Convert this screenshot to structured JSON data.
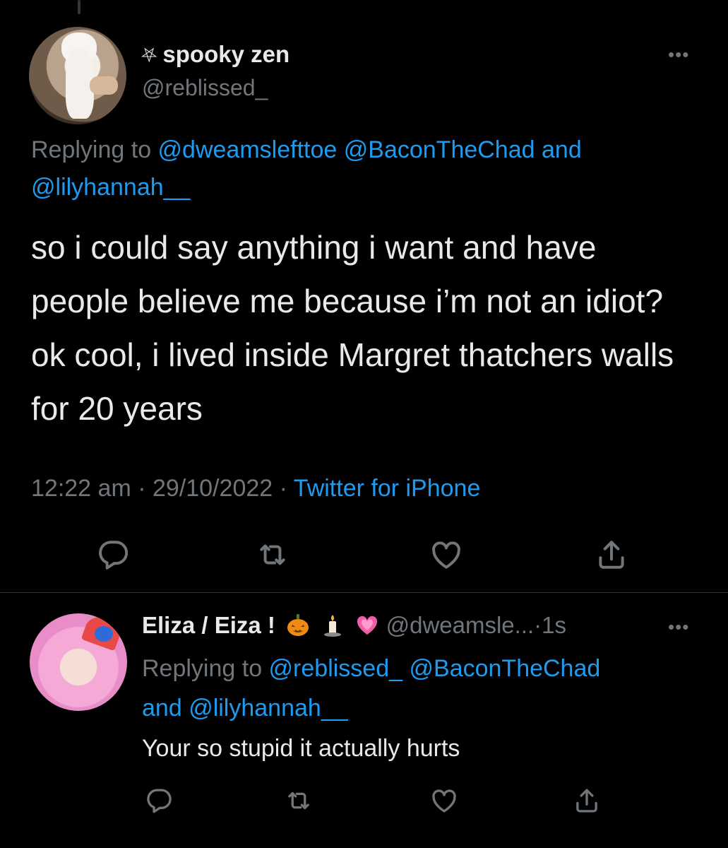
{
  "main_tweet": {
    "display_name": "spooky zen",
    "name_prefix_glyph": "⛧",
    "handle": "@reblissed_",
    "more": "•••",
    "replying_prefix": "Replying to ",
    "mentions": [
      "@dweamslefttoe",
      "@BaconTheChad",
      "@lilyhannah__"
    ],
    "and": "and",
    "text": "so i could say anything i want and have people believe me because i’m not an idiot? ok cool, i lived inside Margret thatchers walls for 20 years",
    "time": "12:22 am",
    "date": "29/10/2022",
    "separator": "·",
    "source": "Twitter for iPhone",
    "actions": [
      "reply-icon",
      "retweet-icon",
      "like-icon",
      "share-icon"
    ]
  },
  "reply_tweet": {
    "display_name": "Eliza / Eiza !",
    "emojis": [
      "jack-o-lantern",
      "candle",
      "sparkling-heart"
    ],
    "handle": "@dweamsle...",
    "time_ago": "1s",
    "separator": "·",
    "more": "•••",
    "replying_prefix": "Replying to ",
    "mentions": [
      "@reblissed_",
      "@BaconTheChad",
      "@lilyhannah__"
    ],
    "and": "and",
    "text": "Your so stupid it actually hurts",
    "actions": [
      "reply-icon",
      "retweet-icon",
      "like-icon",
      "share-icon"
    ]
  },
  "colors": {
    "background": "#000000",
    "text": "#e7e9ea",
    "secondary": "#71767b",
    "link": "#1d9bf0",
    "divider": "#2f3336"
  }
}
